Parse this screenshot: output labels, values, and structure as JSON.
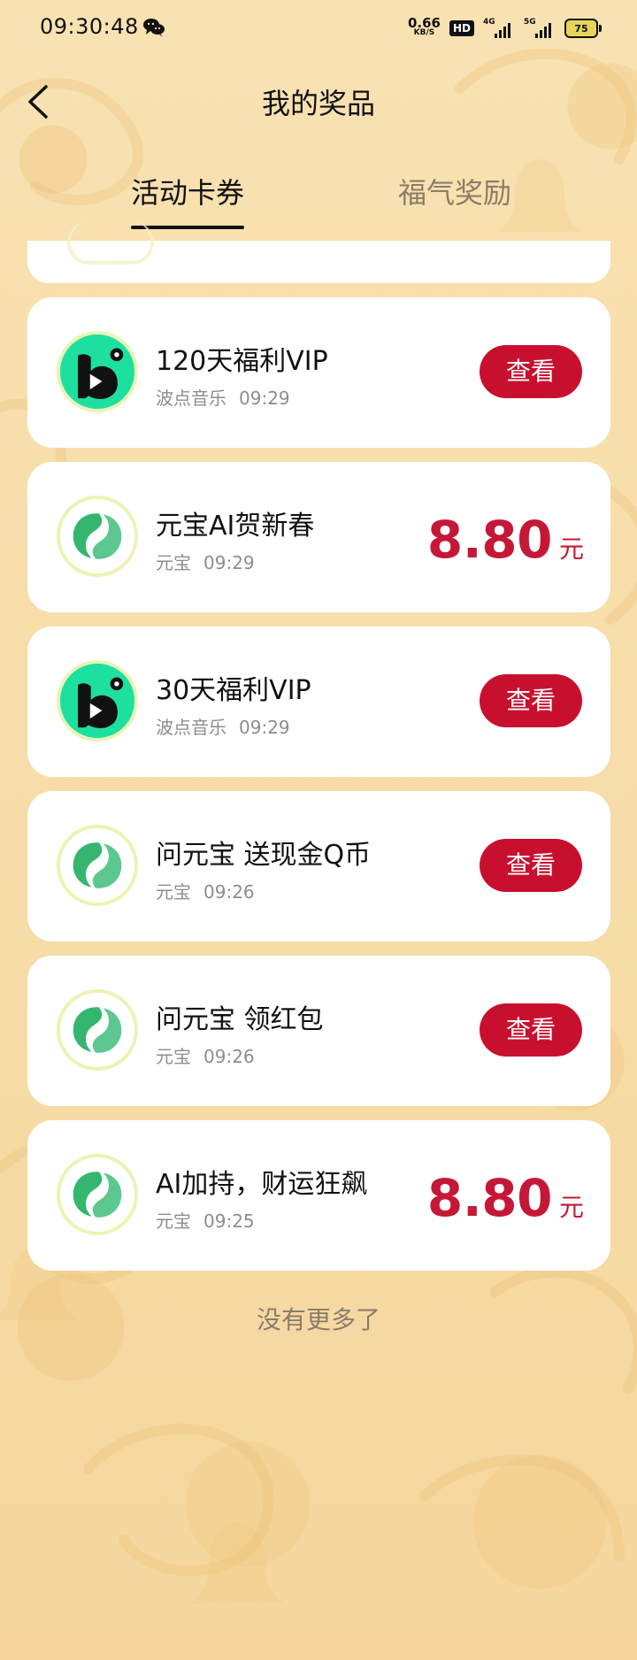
{
  "status_bar": {
    "time": "09:30:48",
    "net_speed_value": "0.66",
    "net_speed_unit": "KB/S",
    "hd": "HD",
    "signal_1": "4G",
    "signal_2": "5G",
    "battery": "75"
  },
  "header": {
    "title": "我的奖品"
  },
  "tabs": [
    {
      "label": "活动卡券",
      "active": true
    },
    {
      "label": "福气奖励",
      "active": false
    }
  ],
  "prizes": [
    {
      "icon": "bodian-music-icon",
      "title": "120天福利VIP",
      "source": "波点音乐",
      "time": "09:29",
      "action": "查看"
    },
    {
      "icon": "yuanbao-icon",
      "title": "元宝AI贺新春",
      "source": "元宝",
      "time": "09:29",
      "amount": "8.80",
      "unit": "元"
    },
    {
      "icon": "bodian-music-icon",
      "title": "30天福利VIP",
      "source": "波点音乐",
      "time": "09:29",
      "action": "查看"
    },
    {
      "icon": "yuanbao-icon",
      "title": "问元宝 送现金Q币",
      "source": "元宝",
      "time": "09:26",
      "action": "查看"
    },
    {
      "icon": "yuanbao-icon",
      "title": "问元宝 领红包",
      "source": "元宝",
      "time": "09:26",
      "action": "查看"
    },
    {
      "icon": "yuanbao-icon",
      "title": "AI加持，财运狂飙",
      "source": "元宝",
      "time": "09:25",
      "amount": "8.80",
      "unit": "元"
    }
  ],
  "footer": {
    "text": "没有更多了"
  },
  "colors": {
    "background": "#f6dda6",
    "primary_button": "#c8102e",
    "amount": "#c51836",
    "bodian_green": "#1de0a0",
    "yuanbao_green": "#28b66e"
  }
}
